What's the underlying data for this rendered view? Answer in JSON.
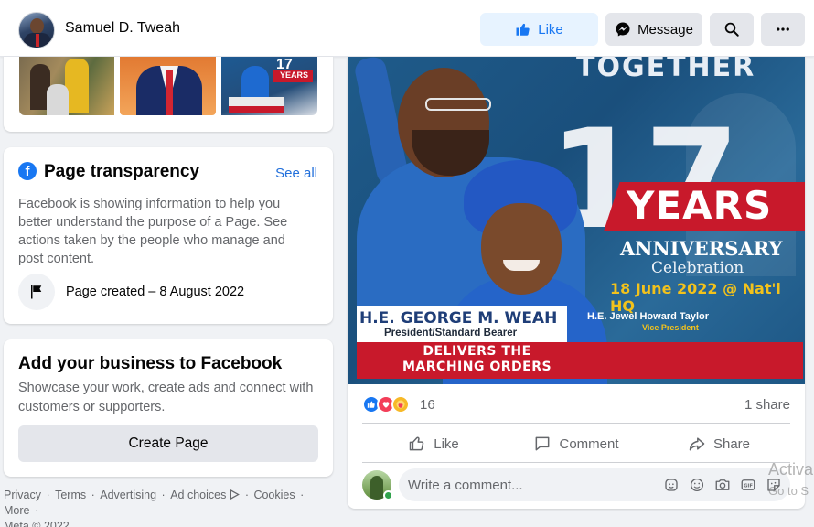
{
  "header": {
    "page_name": "Samuel D. Tweah",
    "like_label": "Like",
    "message_label": "Message"
  },
  "transparency": {
    "title": "Page transparency",
    "see_all": "See all",
    "description": "Facebook is showing information to help you better understand the purpose of a Page. See actions taken by the people who manage and post content.",
    "created": "Page created – 8 August 2022"
  },
  "business": {
    "title": "Add your business to Facebook",
    "description": "Showcase your work, create ads and connect with customers or supporters.",
    "button": "Create Page"
  },
  "footer": {
    "links": [
      "Privacy",
      "Terms",
      "Advertising",
      "Ad choices",
      "Cookies",
      "More"
    ],
    "copyright": "Meta © 2022"
  },
  "photos": {
    "thumb3_number": "17",
    "thumb3_text": "YEARS"
  },
  "post": {
    "image": {
      "together": "TOGETHER",
      "big_number": "17",
      "years": "YEARS",
      "anniversary": "ANNIVERSARY",
      "celebration": "Celebration",
      "date_venue": "18 June 2022 @ Nat'l HQ",
      "weah_name": "H.E. GEORGE M. WEAH",
      "weah_title": "President/Standard Bearer",
      "delivers_line1": "DELIVERS THE",
      "delivers_line2": "MARCHING ORDERS",
      "jewel_name": "H.E. Jewel Howard Taylor",
      "jewel_title": "Vice President"
    },
    "reaction_count": "16",
    "share_count": "1 share",
    "actions": {
      "like": "Like",
      "comment": "Comment",
      "share": "Share"
    },
    "comment_placeholder": "Write a comment..."
  },
  "watermark": {
    "line1": "Activa",
    "line2": "Go to S"
  },
  "colors": {
    "accent": "#1877f2",
    "like_bg": "#e7f3ff",
    "banner_red": "#c8192b",
    "gold": "#f2c21c"
  }
}
